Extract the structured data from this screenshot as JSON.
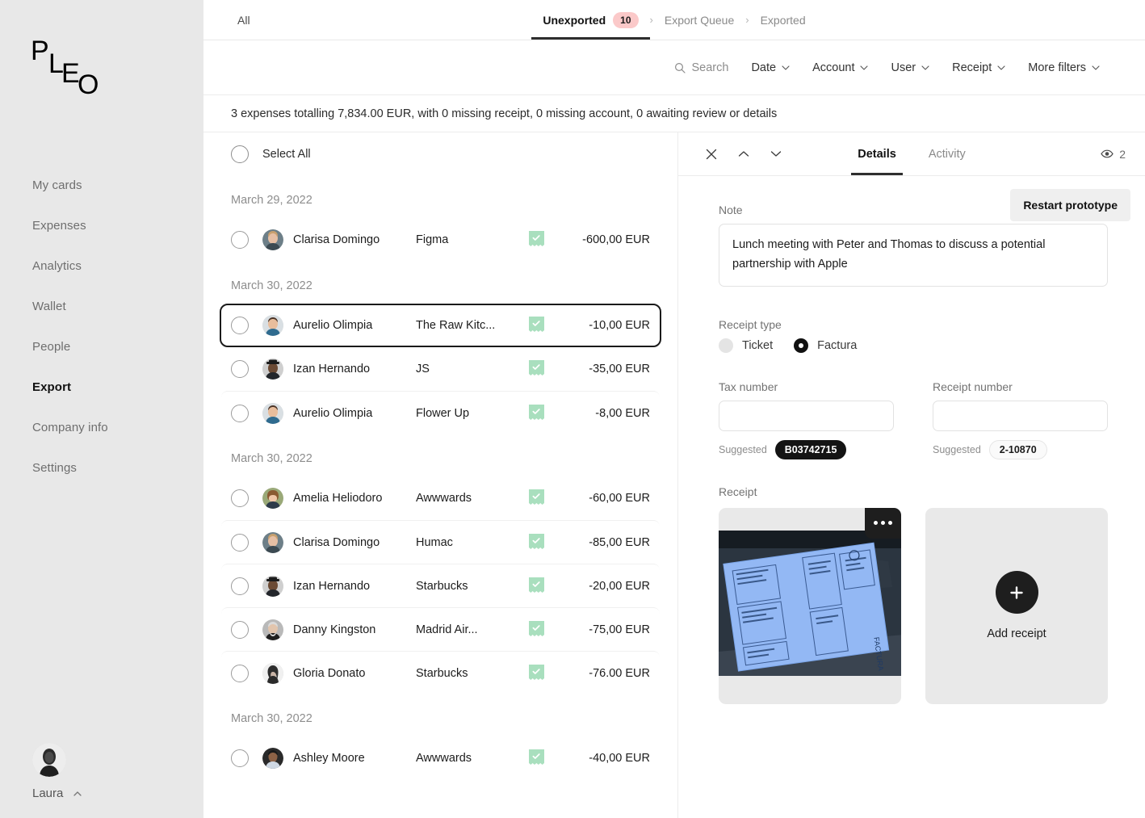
{
  "brand": {
    "logo_text": "PLEO",
    "accent_pink": "#fbc9c9",
    "accent_green": "#a9dfbe",
    "sidebar_bg": "#e8e8e8"
  },
  "sidebar": {
    "items": [
      {
        "label": "My cards",
        "active": false
      },
      {
        "label": "Expenses",
        "active": false
      },
      {
        "label": "Analytics",
        "active": false
      },
      {
        "label": "Wallet",
        "active": false
      },
      {
        "label": "People",
        "active": false
      },
      {
        "label": "Export",
        "active": true
      },
      {
        "label": "Company info",
        "active": false
      },
      {
        "label": "Settings",
        "active": false
      }
    ],
    "user": {
      "name": "Laura"
    }
  },
  "topbar": {
    "all_label": "All",
    "steps": [
      {
        "label": "Unexported",
        "count": "10",
        "active": true
      },
      {
        "label": "Export Queue",
        "count": "",
        "active": false
      },
      {
        "label": "Exported",
        "count": "",
        "active": false
      }
    ],
    "separator": "›"
  },
  "filters": {
    "search_label": "Search",
    "items": [
      {
        "label": "Date"
      },
      {
        "label": "Account"
      },
      {
        "label": "User"
      },
      {
        "label": "Receipt"
      },
      {
        "label": "More filters"
      }
    ]
  },
  "summary": {
    "text": "3 expenses totalling 7,834.00 EUR, with 0 missing receipt, 0 missing account, 0 awaiting review or details"
  },
  "list": {
    "select_all_label": "Select All",
    "groups": [
      {
        "date": "March 29, 2022",
        "rows": [
          {
            "name": "Clarisa Domingo",
            "merchant": "Figma",
            "amount": "-600,00 EUR",
            "receipt": "receipt-check-icon",
            "selected": false,
            "avatar": "avatar-clarisa"
          }
        ]
      },
      {
        "date": "March 30, 2022",
        "rows": [
          {
            "name": "Aurelio Olimpia",
            "merchant": "The Raw Kitc...",
            "amount": "-10,00 EUR",
            "receipt": "receipt-check-icon",
            "selected": true,
            "avatar": "avatar-aurelio"
          },
          {
            "name": "Izan Hernando",
            "merchant": "JS",
            "amount": "-35,00 EUR",
            "receipt": "receipt-check-icon",
            "selected": false,
            "avatar": "avatar-izan"
          },
          {
            "name": "Aurelio Olimpia",
            "merchant": "Flower Up",
            "amount": "-8,00 EUR",
            "receipt": "receipt-check-icon",
            "selected": false,
            "avatar": "avatar-aurelio"
          }
        ]
      },
      {
        "date": "March 30, 2022",
        "rows": [
          {
            "name": "Amelia Heliodoro",
            "merchant": "Awwwards",
            "amount": "-60,00 EUR",
            "receipt": "receipt-check-icon",
            "selected": false,
            "avatar": "avatar-amelia"
          },
          {
            "name": "Clarisa Domingo",
            "merchant": "Humac",
            "amount": "-85,00 EUR",
            "receipt": "receipt-check-icon",
            "selected": false,
            "avatar": "avatar-clarisa"
          },
          {
            "name": "Izan Hernando",
            "merchant": "Starbucks",
            "amount": "-20,00 EUR",
            "receipt": "receipt-check-icon",
            "selected": false,
            "avatar": "avatar-izan"
          },
          {
            "name": "Danny Kingston",
            "merchant": "Madrid Air...",
            "amount": "-75,00 EUR",
            "receipt": "receipt-check-icon",
            "selected": false,
            "avatar": "avatar-danny"
          },
          {
            "name": "Gloria Donato",
            "merchant": "Starbucks",
            "amount": "-76.00 EUR",
            "receipt": "receipt-check-icon",
            "selected": false,
            "avatar": "avatar-gloria"
          }
        ]
      },
      {
        "date": "March 30, 2022",
        "rows": [
          {
            "name": "Ashley Moore",
            "merchant": "Awwwards",
            "amount": "-40,00 EUR",
            "receipt": "receipt-check-icon",
            "selected": false,
            "avatar": "avatar-ashley"
          }
        ]
      }
    ]
  },
  "details": {
    "tabs": [
      {
        "label": "Details",
        "active": true
      },
      {
        "label": "Activity",
        "active": false
      }
    ],
    "view_count": "2",
    "restart_label": "Restart prototype",
    "note": {
      "label": "Note",
      "value": "Lunch meeting with Peter and Thomas to discuss a potential partnership with Apple",
      "placeholder": "Add a note"
    },
    "receipt_type": {
      "label": "Receipt type",
      "options": [
        {
          "label": "Ticket",
          "selected": false
        },
        {
          "label": "Factura",
          "selected": true
        }
      ]
    },
    "tax_number": {
      "label": "Tax number",
      "value": "",
      "placeholder": "",
      "suggested_label": "Suggested",
      "suggested_value": "B03742715"
    },
    "receipt_number": {
      "label": "Receipt number",
      "value": "",
      "placeholder": "",
      "suggested_label": "Suggested",
      "suggested_value": "2-10870"
    },
    "receipt": {
      "label": "Receipt",
      "add_label": "Add receipt"
    }
  }
}
